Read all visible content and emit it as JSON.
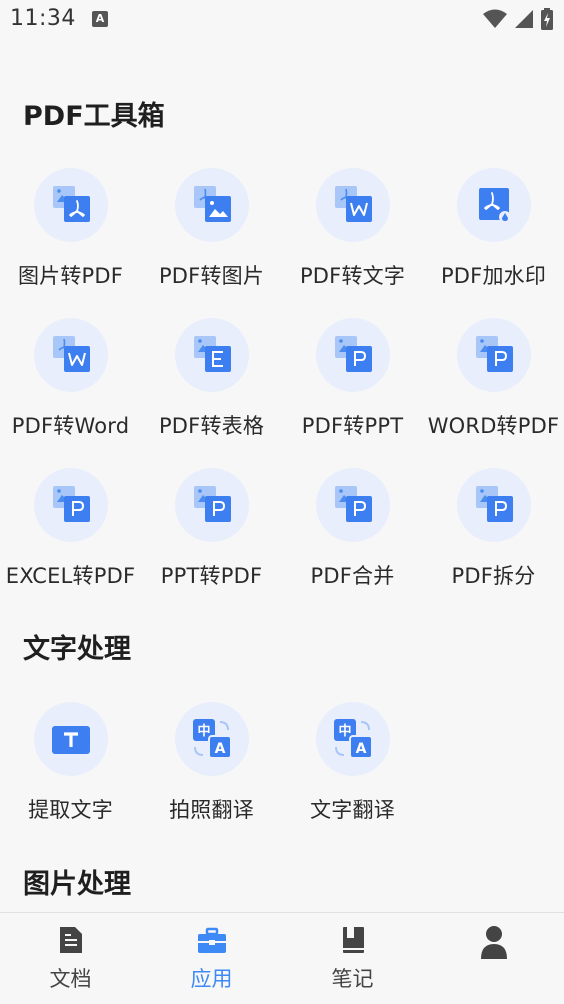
{
  "status_bar": {
    "time": "11:34",
    "notification_icon": "a-icon",
    "icons": [
      "wifi-icon",
      "signal-icon",
      "battery-icon"
    ]
  },
  "sections": {
    "pdf_tools": {
      "title": "PDF工具箱",
      "items": [
        {
          "label": "图片转PDF",
          "icon": "image-to-pdf-icon"
        },
        {
          "label": "PDF转图片",
          "icon": "pdf-to-image-icon"
        },
        {
          "label": "PDF转文字",
          "icon": "pdf-to-text-icon"
        },
        {
          "label": "PDF加水印",
          "icon": "pdf-watermark-icon"
        },
        {
          "label": "PDF转Word",
          "icon": "pdf-to-word-icon"
        },
        {
          "label": "PDF转表格",
          "icon": "pdf-to-excel-icon"
        },
        {
          "label": "PDF转PPT",
          "icon": "pdf-to-ppt-icon"
        },
        {
          "label": "WORD转PDF",
          "icon": "word-to-pdf-icon"
        },
        {
          "label": "EXCEL转PDF",
          "icon": "excel-to-pdf-icon"
        },
        {
          "label": "PPT转PDF",
          "icon": "ppt-to-pdf-icon"
        },
        {
          "label": "PDF合并",
          "icon": "pdf-merge-icon"
        },
        {
          "label": "PDF拆分",
          "icon": "pdf-split-icon"
        }
      ]
    },
    "text_processing": {
      "title": "文字处理",
      "items": [
        {
          "label": "提取文字",
          "icon": "extract-text-icon"
        },
        {
          "label": "拍照翻译",
          "icon": "photo-translate-icon"
        },
        {
          "label": "文字翻译",
          "icon": "text-translate-icon"
        }
      ]
    },
    "image_processing": {
      "title": "图片处理"
    }
  },
  "bottom_nav": {
    "items": [
      {
        "label": "文档",
        "icon": "document-icon",
        "active": false
      },
      {
        "label": "应用",
        "icon": "toolbox-icon",
        "active": true
      },
      {
        "label": "笔记",
        "icon": "notebook-icon",
        "active": false
      },
      {
        "label": "",
        "icon": "profile-icon",
        "active": false
      }
    ]
  },
  "colors": {
    "accent": "#3d8af7",
    "icon_bg": "#e8eefb",
    "background": "#f7f7f7"
  }
}
